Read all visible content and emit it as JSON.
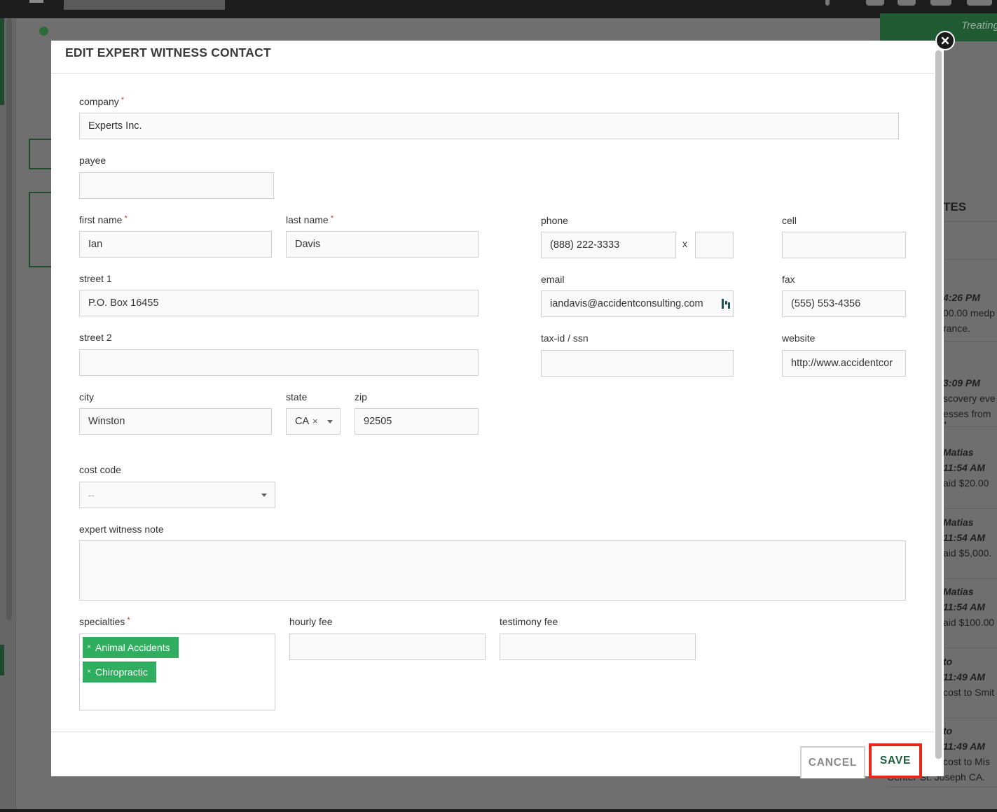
{
  "modal": {
    "title": "EDIT EXPERT WITNESS CONTACT",
    "close_icon": "close-icon"
  },
  "fields": {
    "company": {
      "label": "company",
      "value": "Experts Inc.",
      "required": true
    },
    "payee": {
      "label": "payee",
      "value": ""
    },
    "first_name": {
      "label": "first name",
      "value": "Ian",
      "required": true
    },
    "last_name": {
      "label": "last name",
      "value": "Davis",
      "required": true
    },
    "phone": {
      "label": "phone",
      "value": "(888) 222-3333",
      "ext_separator": "x",
      "ext_value": ""
    },
    "cell": {
      "label": "cell",
      "value": ""
    },
    "street1": {
      "label": "street 1",
      "value": "P.O. Box 16455"
    },
    "email": {
      "label": "email",
      "value": "iandavis@accidentconsulting.com"
    },
    "fax": {
      "label": "fax",
      "value": "(555) 553-4356"
    },
    "street2": {
      "label": "street 2",
      "value": ""
    },
    "tax_id": {
      "label": "tax-id / ssn",
      "value": ""
    },
    "website": {
      "label": "website",
      "value": "http://www.accidentcor"
    },
    "city": {
      "label": "city",
      "value": "Winston"
    },
    "state": {
      "label": "state",
      "value": "CA",
      "clear": "×"
    },
    "zip": {
      "label": "zip",
      "value": "92505"
    },
    "cost_code": {
      "label": "cost code",
      "value": "--"
    },
    "note": {
      "label": "expert witness note",
      "value": ""
    },
    "specialties": {
      "label": "specialties",
      "required": true,
      "tags": [
        {
          "label": "Animal Accidents",
          "remove": "×"
        },
        {
          "label": "Chiropractic",
          "remove": "×"
        }
      ]
    },
    "hourly_fee": {
      "label": "hourly fee",
      "value": ""
    },
    "testimony_fee": {
      "label": "testimony fee",
      "value": ""
    }
  },
  "required_mark": "*",
  "footer": {
    "cancel_label": "CANCEL",
    "save_label": "SAVE"
  },
  "background": {
    "treating_label": "Treating",
    "tes_label": "TES",
    "feed": [
      {
        "time": "4:26 PM",
        "lines": [
          "00.00 medp",
          "rance."
        ]
      },
      {
        "time": "3:09 PM",
        "lines": [
          "scovery eve",
          "esses from \""
        ]
      },
      {
        "name": "Matias",
        "time": "11:54 AM",
        "lines": [
          "aid $20.00"
        ]
      },
      {
        "name": "Matias",
        "time": "11:54 AM",
        "lines": [
          "aid $5,000."
        ]
      },
      {
        "name": "Matias",
        "time": "11:54 AM",
        "lines": [
          "aid $100.00"
        ]
      },
      {
        "name": "to",
        "time": "11:49 AM",
        "lines": [
          "cost to Smit"
        ]
      },
      {
        "name": "to",
        "time": "11:49 AM",
        "lines": [
          "cost to Mis",
          "Center-St. Joseph CA."
        ]
      }
    ]
  },
  "colors": {
    "accent_green": "#2fae5f",
    "save_text": "#1b5a3b",
    "highlight_red": "#e8261a",
    "required_red": "#c0392b"
  }
}
